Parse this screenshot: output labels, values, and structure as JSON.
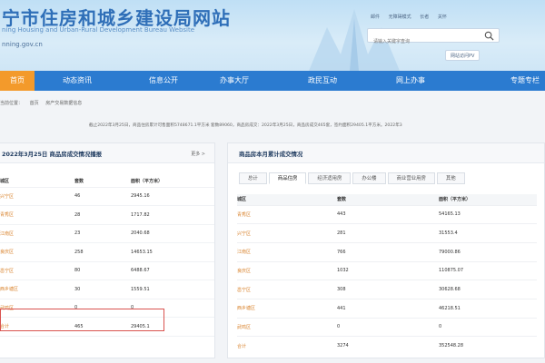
{
  "header": {
    "title": "宁市住房和城乡建设局网站",
    "subtitle": "ning Housing and Urban-Rural Development Bureau Website",
    "url": "nning.gov.cn",
    "top_links": [
      "邮件",
      "无障碍模式",
      "长者",
      "关怀"
    ],
    "search_placeholder": "请输入关键字查询",
    "pv_button": "网站访问PV"
  },
  "nav": {
    "items": [
      {
        "label": "首页",
        "active": true
      },
      {
        "label": "动态资讯"
      },
      {
        "label": "信息公开"
      },
      {
        "label": "办事大厅"
      },
      {
        "label": "政民互动"
      },
      {
        "label": "网上办事"
      },
      {
        "label": "专题专栏"
      }
    ]
  },
  "breadcrumb": {
    "prefix": "当前位置：",
    "items": [
      "首页",
      "房产交易数据信息"
    ]
  },
  "notice": "截止2022年3月25日，商品住房累计可售面积5748671.1平方米 套数89060，商品房成交：2022年3月25日，商品房成交465套，签约面积29405.1平方米。2022年3",
  "left_panel": {
    "title": "2022年3月25日 商品房成交情况播报",
    "more": "更多 >",
    "columns": [
      "城区",
      "套数",
      "面积（平方米）"
    ],
    "rows": [
      {
        "district": "兴宁区",
        "count": "46",
        "area": "2945.16"
      },
      {
        "district": "青秀区",
        "count": "28",
        "area": "1717.82"
      },
      {
        "district": "江南区",
        "count": "23",
        "area": "2040.68"
      },
      {
        "district": "良庆区",
        "count": "258",
        "area": "14653.15"
      },
      {
        "district": "邕宁区",
        "count": "80",
        "area": "6488.67"
      },
      {
        "district": "西乡塘区",
        "count": "30",
        "area": "1559.51"
      },
      {
        "district": "武鸣区",
        "count": "0",
        "area": "0"
      },
      {
        "district": "合计",
        "count": "465",
        "area": "29405.1"
      }
    ]
  },
  "right_panel": {
    "title": "商品房本月累计成交情况",
    "tabs": [
      {
        "label": "总计"
      },
      {
        "label": "商品住房",
        "active": true
      },
      {
        "label": "经济适用房"
      },
      {
        "label": "办公楼"
      },
      {
        "label": "商业营业用房"
      },
      {
        "label": "其他"
      }
    ],
    "columns": [
      "城区",
      "套数",
      "面积（平方米）"
    ],
    "rows": [
      {
        "district": "青秀区",
        "count": "443",
        "area": "54165.13"
      },
      {
        "district": "兴宁区",
        "count": "281",
        "area": "31553.4"
      },
      {
        "district": "江南区",
        "count": "766",
        "area": "79000.86"
      },
      {
        "district": "良庆区",
        "count": "1032",
        "area": "110875.07"
      },
      {
        "district": "邕宁区",
        "count": "308",
        "area": "30628.68"
      },
      {
        "district": "西乡塘区",
        "count": "441",
        "area": "46218.51"
      },
      {
        "district": "武鸣区",
        "count": "0",
        "area": "0"
      },
      {
        "district": "合计",
        "count": "3274",
        "area": "352548.28"
      }
    ]
  }
}
